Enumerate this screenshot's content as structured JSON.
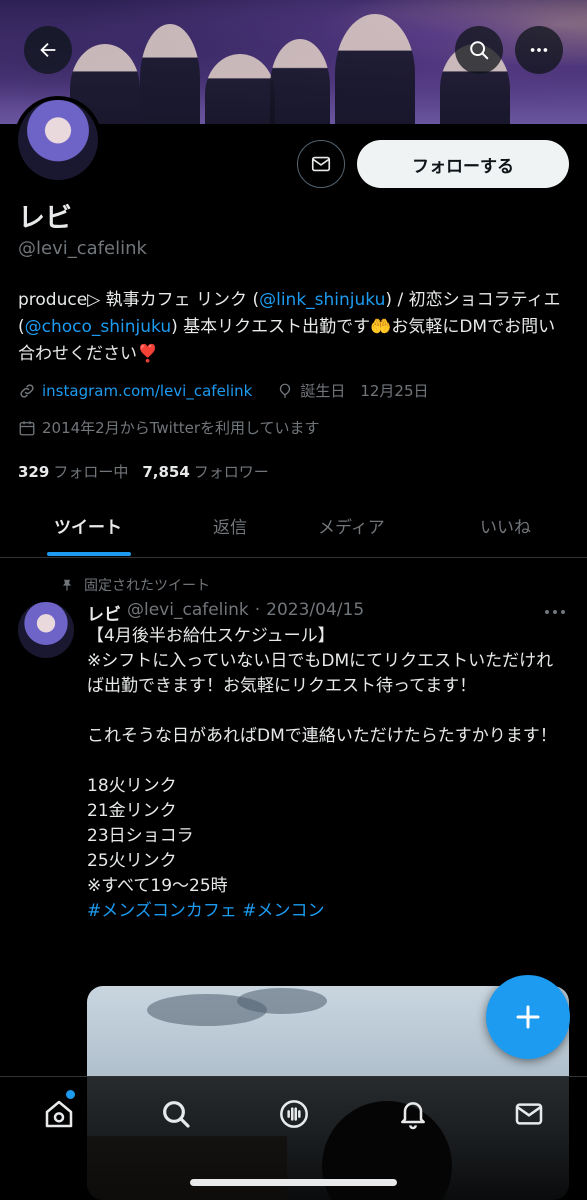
{
  "colors": {
    "accent": "#1d9bf0",
    "text": "#e7e9ea",
    "muted": "#71767b",
    "background": "#000000"
  },
  "header": {
    "back_icon": "arrow-left-icon",
    "search_icon": "search-icon",
    "more_icon": "more-horizontal-icon"
  },
  "profile": {
    "display_name": "レビ",
    "handle": "@levi_cafelink",
    "follow_label": "フォローする",
    "bio": {
      "part1": "produce▷ 執事カフェ リンク (",
      "mention1": "@link_shinjuku",
      "part2": ") / 初恋ショコラティエ (",
      "mention2": "@choco_shinjuku",
      "part3": ") 基本リクエスト出勤です🤲お気軽にDMでお問い合わせください❣️"
    },
    "website": "instagram.com/levi_cafelink",
    "birthday": "誕生日　12月25日",
    "joined": "2014年2月からTwitterを利用しています",
    "following_count": "329",
    "following_label": "フォロー中",
    "followers_count": "7,854",
    "followers_label": "フォロワー"
  },
  "tabs": [
    "ツイート",
    "返信",
    "メディア",
    "いいね"
  ],
  "tweet": {
    "pinned_label": "固定されたツイート",
    "author_name": "レビ",
    "author_handle": "@levi_cafelink",
    "date": "2023/04/15",
    "body": "【4月後半お給仕スケジュール】\n※シフトに入っていない日でもDMにてリクエストいただければ出勤できます！お気軽にリクエスト待ってます！\n\nこれそうな日があればDMで連絡いただけたらたすかります！\n\n18火リンク\n21金リンク\n23日ショコラ\n25火リンク\n※すべて19〜25時\n",
    "hashtags": "#メンズコンカフェ #メンコン"
  },
  "bottom_nav": [
    "home-icon",
    "search-icon",
    "spaces-icon",
    "bell-icon",
    "mail-icon"
  ]
}
